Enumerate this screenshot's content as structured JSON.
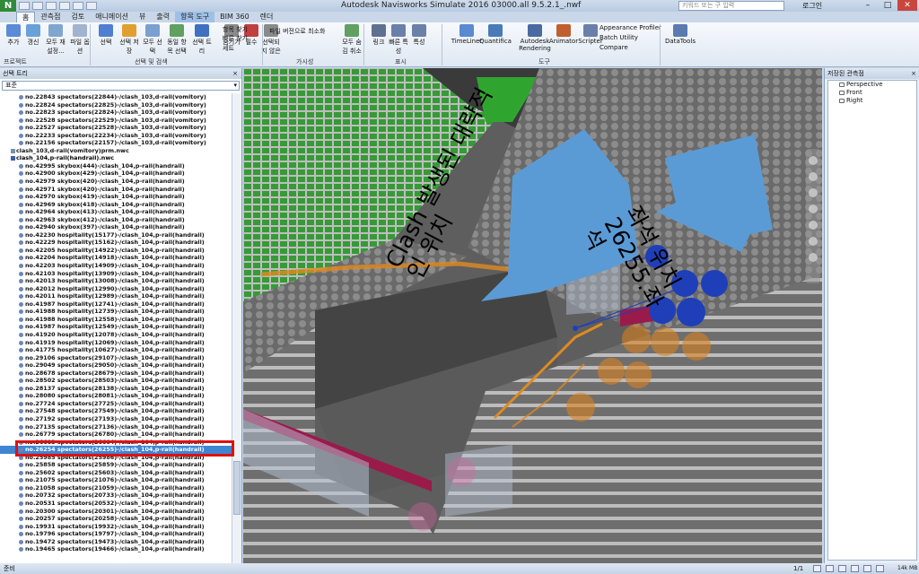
{
  "app": {
    "logo": "N",
    "title": "Autodesk Navisworks Simulate 2016    03000.all 9.5.2.1_.nwf",
    "search_placeholder": "키워드 또는 구 입력",
    "signin": "로그인"
  },
  "ribbon_tabs": [
    "홈",
    "관측점",
    "검토",
    "애니메이션",
    "뷰",
    "출력",
    "항목 도구",
    "BIM 360",
    "렌더"
  ],
  "ribbon": {
    "buttons": [
      {
        "label": "추가",
        "color": "#5b8ad6"
      },
      {
        "label": "갱신",
        "color": "#6aa0d8"
      },
      {
        "label": "모두 재설정...",
        "color": "#7fa6cf"
      },
      {
        "label": "파일 옵션",
        "color": "#a0b4d0"
      },
      {
        "label": "선택",
        "color": "#4f7fd0"
      },
      {
        "label": "선택 저장",
        "color": "#e0a030"
      },
      {
        "label": "모두 선택",
        "color": "#7aa0d0"
      },
      {
        "label": "동일 항목 선택",
        "color": "#60a060"
      },
      {
        "label": "선택 트리",
        "color": "#4070c0"
      },
      {
        "label": "숨기기",
        "color": "#8a8a8a"
      },
      {
        "label": "필수",
        "color": "#c04040"
      },
      {
        "label": "선택되지 않은 항목 숨기기",
        "color": "#8a8a8a"
      },
      {
        "label": "모두 숨김 취소",
        "color": "#60a060"
      },
      {
        "label": "링크",
        "color": "#607090"
      },
      {
        "label": "빠른 특성",
        "color": "#6a80a8"
      },
      {
        "label": "특성",
        "color": "#6a80a8"
      },
      {
        "label": "TimeLiner",
        "color": "#5a8ad0"
      },
      {
        "label": "Quantification",
        "color": "#4a7ab8"
      },
      {
        "label": "Autodesk Rendering",
        "color": "#4a6aa0"
      },
      {
        "label": "Animator",
        "color": "#c06030"
      },
      {
        "label": "Scripter",
        "color": "#6a80a8"
      },
      {
        "label": "DataTools",
        "color": "#5a7ab0"
      }
    ],
    "small_buttons": {
      "find_items": "항목 찾기",
      "quick_find": "빠른 찾기",
      "sets": "세트",
      "hide_required": "파일 버전으로 최소화",
      "appearance_profiler": "Appearance Profiler",
      "batch_utility": "Batch Utility",
      "compare": "Compare"
    },
    "groups": [
      "프로젝트",
      "선택 및 검색",
      "가시성",
      "표시",
      "도구"
    ]
  },
  "left_pane": {
    "title": "선택 트리",
    "combo_value": "표준",
    "selected_index": 46,
    "rows": [
      {
        "text": "no.22843 spectators(22844)-/clash_103,d-rail(vomitory)",
        "kind": "item"
      },
      {
        "text": "no.22824 spectators(22825)-/clash_103,d-rail(vomitory)",
        "kind": "item"
      },
      {
        "text": "no.22823 spectators(22824)-/clash_103,d-rail(vomitory)",
        "kind": "item"
      },
      {
        "text": "no.22528 spectators(22529)-/clash_103,d-rail(vomitory)",
        "kind": "item"
      },
      {
        "text": "no.22527 spectators(22528)-/clash_103,d-rail(vomitory)",
        "kind": "item"
      },
      {
        "text": "no.22233 spectators(22234)-/clash_103,d-rail(vomitory)",
        "kind": "item"
      },
      {
        "text": "no.22156 spectators(22157)-/clash_103,d-rail(vomitory)",
        "kind": "item"
      },
      {
        "text": "clash_103,d-rail(vomitory)prm.nwc",
        "kind": "group"
      },
      {
        "text": "clash_104,p-rail(handrail).nwc",
        "kind": "group-open"
      },
      {
        "text": "no.42995 skybox(444)-/clash_104,p-rail(handrail)",
        "kind": "item"
      },
      {
        "text": "no.42900 skybox(429)-/clash_104,p-rail(handrail)",
        "kind": "item"
      },
      {
        "text": "no.42979 skybox(420)-/clash_104,p-rail(handrail)",
        "kind": "item"
      },
      {
        "text": "no.42971 skybox(420)-/clash_104,p-rail(handrail)",
        "kind": "item"
      },
      {
        "text": "no.42970 skybox(419)-/clash_104,p-rail(handrail)",
        "kind": "item"
      },
      {
        "text": "no.42969 skybox(418)-/clash_104,p-rail(handrail)",
        "kind": "item"
      },
      {
        "text": "no.42964 skybox(413)-/clash_104,p-rail(handrail)",
        "kind": "item"
      },
      {
        "text": "no.42963 skybox(412)-/clash_104,p-rail(handrail)",
        "kind": "item"
      },
      {
        "text": "no.42940 skybox(397)-/clash_104,p-rail(handrail)",
        "kind": "item"
      },
      {
        "text": "no.42230 hospitality(15177)-/clash_104,p-rail(handrail)",
        "kind": "item"
      },
      {
        "text": "no.42229 hospitality(15162)-/clash_104,p-rail(handrail)",
        "kind": "item"
      },
      {
        "text": "no.42205 hospitality(14922)-/clash_104,p-rail(handrail)",
        "kind": "item"
      },
      {
        "text": "no.42204 hospitality(14918)-/clash_104,p-rail(handrail)",
        "kind": "item"
      },
      {
        "text": "no.42203 hospitality(14909)-/clash_104,p-rail(handrail)",
        "kind": "item"
      },
      {
        "text": "no.42103 hospitality(13909)-/clash_104,p-rail(handrail)",
        "kind": "item"
      },
      {
        "text": "no.42013 hospitality(13008)-/clash_104,p-rail(handrail)",
        "kind": "item"
      },
      {
        "text": "no.42012 hospitality(12990)-/clash_104,p-rail(handrail)",
        "kind": "item"
      },
      {
        "text": "no.42011 hospitality(12989)-/clash_104,p-rail(handrail)",
        "kind": "item"
      },
      {
        "text": "no.41987 hospitality(12741)-/clash_104,p-rail(handrail)",
        "kind": "item"
      },
      {
        "text": "no.41988 hospitality(12739)-/clash_104,p-rail(handrail)",
        "kind": "item"
      },
      {
        "text": "no.41988 hospitality(12558)-/clash_104,p-rail(handrail)",
        "kind": "item"
      },
      {
        "text": "no.41987 hospitality(12549)-/clash_104,p-rail(handrail)",
        "kind": "item"
      },
      {
        "text": "no.41920 hospitality(12078)-/clash_104,p-rail(handrail)",
        "kind": "item"
      },
      {
        "text": "no.41919 hospitality(12069)-/clash_104,p-rail(handrail)",
        "kind": "item"
      },
      {
        "text": "no.41775 hospitality(10627)-/clash_104,p-rail(handrail)",
        "kind": "item"
      },
      {
        "text": "no.29106 spectators(29107)-/clash_104,p-rail(handrail)",
        "kind": "item"
      },
      {
        "text": "no.29049 spectators(29050)-/clash_104,p-rail(handrail)",
        "kind": "item"
      },
      {
        "text": "no.28678 spectators(28679)-/clash_104,p-rail(handrail)",
        "kind": "item"
      },
      {
        "text": "no.28502 spectators(28503)-/clash_104,p-rail(handrail)",
        "kind": "item"
      },
      {
        "text": "no.28137 spectators(28138)-/clash_104,p-rail(handrail)",
        "kind": "item"
      },
      {
        "text": "no.28080 spectators(28081)-/clash_104,p-rail(handrail)",
        "kind": "item"
      },
      {
        "text": "no.27724 spectators(27725)-/clash_104,p-rail(handrail)",
        "kind": "item"
      },
      {
        "text": "no.27548 spectators(27549)-/clash_104,p-rail(handrail)",
        "kind": "item"
      },
      {
        "text": "no.27192 spectators(27193)-/clash_104,p-rail(handrail)",
        "kind": "item"
      },
      {
        "text": "no.27135 spectators(27136)-/clash_104,p-rail(handrail)",
        "kind": "item"
      },
      {
        "text": "no.26779 spectators(26780)-/clash_104,p-rail(handrail)",
        "kind": "item"
      },
      {
        "text": "no.26603 spectators(26604)-/clash_104,p-rail(handrail)",
        "kind": "item"
      },
      {
        "text": "no.26254 spectators(26255)-/clash_104,p-rail(handrail)",
        "kind": "item"
      },
      {
        "text": "no.25985 spectators(25986)-/clash_104,p-rail(handrail)",
        "kind": "item"
      },
      {
        "text": "no.25858 spectators(25859)-/clash_104,p-rail(handrail)",
        "kind": "item"
      },
      {
        "text": "no.25602 spectators(25603)-/clash_104,p-rail(handrail)",
        "kind": "item"
      },
      {
        "text": "no.21075 spectators(21076)-/clash_104,p-rail(handrail)",
        "kind": "item"
      },
      {
        "text": "no.21058 spectators(21059)-/clash_104,p-rail(handrail)",
        "kind": "item"
      },
      {
        "text": "no.20732 spectators(20733)-/clash_104,p-rail(handrail)",
        "kind": "item"
      },
      {
        "text": "no.20531 spectators(20532)-/clash_104,p-rail(handrail)",
        "kind": "item"
      },
      {
        "text": "no.20300 spectators(20301)-/clash_104,p-rail(handrail)",
        "kind": "item"
      },
      {
        "text": "no.20257 spectators(20258)-/clash_104,p-rail(handrail)",
        "kind": "item"
      },
      {
        "text": "no.19931 spectators(19932)-/clash_104,p-rail(handrail)",
        "kind": "item"
      },
      {
        "text": "no.19796 spectators(19797)-/clash_104,p-rail(handrail)",
        "kind": "item"
      },
      {
        "text": "no.19472 spectators(19473)-/clash_104,p-rail(handrail)",
        "kind": "item"
      },
      {
        "text": "no.19465 spectators(19466)-/clash_104,p-rail(handrail)",
        "kind": "item"
      }
    ]
  },
  "viewport": {
    "callout_1": "Clash 발생된 대략적\n인 위치",
    "callout_2": "좌석 위치\n26255.좌\n석",
    "colors": {
      "arrow": "#5b9bd5",
      "clash_sphere": "#1f3fb8",
      "clash_sphere_orange": "#d9801e",
      "seats_green": "#2fa52f",
      "rail_orange": "#e08a20"
    }
  },
  "right_pane": {
    "title": "저장된 관측점",
    "views": [
      "Perspective",
      "Front",
      "Right"
    ]
  },
  "statusbar": {
    "left": "준비",
    "page": "1/1",
    "memory": "14k MB"
  }
}
